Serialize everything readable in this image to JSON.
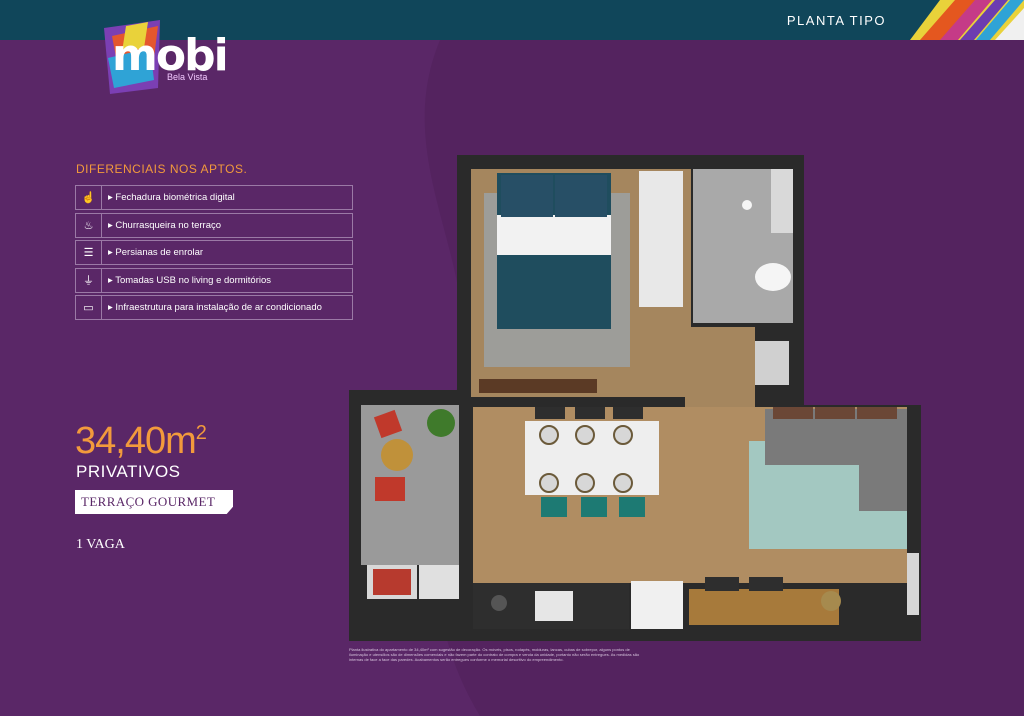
{
  "header": {
    "title": "PLANTA TIPO"
  },
  "brand": {
    "name": "mobi",
    "subtitle": "Bela Vista"
  },
  "features": {
    "title": "DIFERENCIAIS NOS APTOS.",
    "items": [
      {
        "icon": "fingerprint-icon",
        "label": "▸ Fechadura biométrica digital"
      },
      {
        "icon": "grill-icon",
        "label": "▸ Churrasqueira no terraço"
      },
      {
        "icon": "blinds-icon",
        "label": "▸ Persianas de enrolar"
      },
      {
        "icon": "usb-icon",
        "label": "▸ Tomadas USB no living e dormitórios"
      },
      {
        "icon": "air-conditioner-icon",
        "label": "▸ Infraestrutura para instalação de ar condicionado"
      }
    ]
  },
  "summary": {
    "area_value": "34,40m",
    "area_sup": "2",
    "area_label": "PRIVATIVOS",
    "terrace_badge": "TERRAÇO GOURMET",
    "parking": "1 VAGA"
  },
  "disclaimer": "Planta ilustrativa do apartamento de 34,40m² com sugestão de decoração. Os móveis, pisos, rodapés, molduras, lancas, cubas de sobrepor, alguns pontos de iluminação e utensílios são de dimensões comerciais e não fazem parte do contrato de compra e venda da unidade, portanto não serão entregues. As medidas são internas de face a face das paredes. Acabamentos serão entregues conforme o memorial descritivo do empreendimento.",
  "colors": {
    "background": "#5a2767",
    "topbar": "#10465a",
    "accent": "#f29a3c"
  }
}
